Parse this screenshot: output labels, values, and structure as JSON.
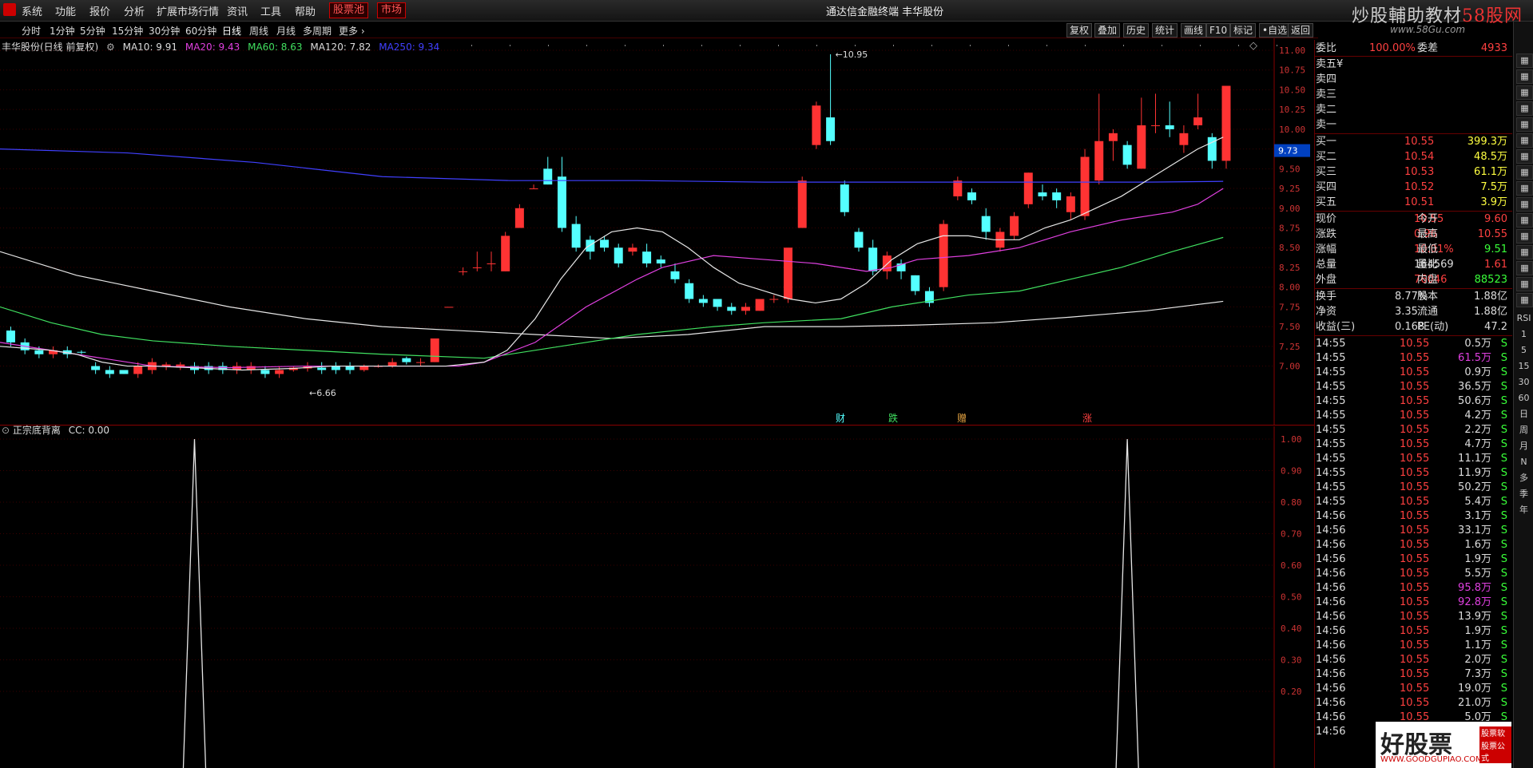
{
  "menubar": {
    "items": [
      "系统",
      "功能",
      "报价",
      "分析",
      "扩展市场行情",
      "资讯",
      "工具",
      "帮助"
    ],
    "boxed": [
      "股票池",
      "市场"
    ],
    "title": "通达信金融终端  丰华股份",
    "brand_a": "炒股輔助教材",
    "brand_b": "58股网",
    "brand_url": "www.58Gu.com"
  },
  "periods": [
    "分时",
    "1分钟",
    "5分钟",
    "15分钟",
    "30分钟",
    "60分钟",
    "日线",
    "周线",
    "月线",
    "多周期",
    "更多 ›"
  ],
  "tools": [
    "复权",
    "叠加",
    "历史",
    "统计",
    "画线",
    "F10",
    "标记",
    "•自选",
    "返回"
  ],
  "price_chart": {
    "title": "丰华股份(日线 前复权)",
    "ma10_label": "MA10: 9.91",
    "ma20_label": "MA20: 9.43",
    "ma60_label": "MA60: 8.63",
    "ma120_label": "MA120: 7.82",
    "ma250_label": "MA250: 9.34",
    "colors": {
      "ma10": "#e6e6e6",
      "ma20": "#e040e0",
      "ma60": "#40e060",
      "ma120": "#e6e6e6",
      "ma250": "#4040ff",
      "up": "#ff3333",
      "down": "#54ffff"
    },
    "y_ticks": [
      "11.00",
      "10.75",
      "10.50",
      "10.25",
      "10.00",
      "9.75",
      "9.50",
      "9.25",
      "9.00",
      "8.75",
      "8.50",
      "8.25",
      "8.00",
      "7.75",
      "7.50",
      "7.25",
      "7.00"
    ],
    "high_label": "10.95",
    "low_label": "6.66",
    "price_tag": "9.73",
    "events": [
      "财",
      "跌",
      "赠",
      "涨"
    ],
    "candles": [
      [
        7.45,
        7.3,
        7.5,
        7.25
      ],
      [
        7.3,
        7.2,
        7.35,
        7.15
      ],
      [
        7.2,
        7.15,
        7.25,
        7.1
      ],
      [
        7.15,
        7.2,
        7.25,
        7.1
      ],
      [
        7.2,
        7.15,
        7.25,
        7.1
      ],
      [
        7.18,
        7.17,
        7.2,
        7.15
      ],
      [
        7.0,
        6.95,
        7.05,
        6.9
      ],
      [
        6.95,
        6.9,
        7.0,
        6.85
      ],
      [
        6.95,
        6.9,
        6.95,
        6.9
      ],
      [
        6.9,
        7.0,
        7.05,
        6.85
      ],
      [
        6.95,
        7.05,
        7.1,
        6.9
      ],
      [
        7.0,
        7.02,
        7.05,
        6.95
      ],
      [
        6.98,
        7.02,
        7.05,
        6.95
      ],
      [
        7.0,
        6.95,
        7.05,
        6.9
      ],
      [
        7.0,
        6.95,
        7.05,
        6.9
      ],
      [
        7.0,
        6.95,
        7.05,
        6.9
      ],
      [
        6.95,
        7.0,
        7.05,
        6.9
      ],
      [
        6.95,
        7.0,
        7.05,
        6.9
      ],
      [
        6.95,
        6.9,
        7.0,
        6.85
      ],
      [
        6.9,
        6.95,
        7.0,
        6.85
      ],
      [
        6.95,
        6.98,
        7.0,
        6.93
      ],
      [
        6.97,
        7.0,
        7.05,
        6.93
      ],
      [
        6.98,
        6.95,
        7.05,
        6.9
      ],
      [
        7.0,
        6.95,
        7.05,
        6.9
      ],
      [
        7.0,
        6.95,
        7.05,
        6.9
      ],
      [
        6.95,
        7.0,
        7.02,
        6.93
      ],
      [
        7.0,
        7.0,
        7.02,
        6.98
      ],
      [
        7.0,
        7.05,
        7.1,
        6.98
      ],
      [
        7.1,
        7.05,
        7.12,
        7.02
      ],
      [
        7.05,
        7.05,
        7.1,
        7.0
      ],
      [
        7.05,
        7.35,
        7.35,
        7.05
      ],
      [
        7.75,
        7.75,
        7.75,
        7.75
      ],
      [
        8.2,
        8.2,
        8.25,
        8.15
      ],
      [
        8.25,
        8.25,
        8.45,
        8.2
      ],
      [
        8.3,
        8.3,
        8.45,
        8.2
      ],
      [
        8.2,
        8.65,
        8.7,
        8.2
      ],
      [
        8.75,
        9.0,
        9.05,
        8.75
      ],
      [
        9.25,
        9.25,
        9.3,
        9.25
      ],
      [
        9.5,
        9.3,
        9.65,
        9.3
      ],
      [
        9.4,
        8.75,
        9.65,
        8.7
      ],
      [
        8.8,
        8.5,
        8.9,
        8.45
      ],
      [
        8.6,
        8.45,
        8.65,
        8.35
      ],
      [
        8.6,
        8.5,
        8.65,
        8.45
      ],
      [
        8.5,
        8.3,
        8.55,
        8.25
      ],
      [
        8.45,
        8.5,
        8.55,
        8.4
      ],
      [
        8.45,
        8.3,
        8.55,
        8.25
      ],
      [
        8.35,
        8.3,
        8.4,
        8.25
      ],
      [
        8.2,
        8.1,
        8.3,
        8.05
      ],
      [
        8.05,
        7.85,
        8.1,
        7.8
      ],
      [
        7.85,
        7.8,
        7.9,
        7.75
      ],
      [
        7.85,
        7.75,
        7.85,
        7.7
      ],
      [
        7.75,
        7.7,
        7.8,
        7.65
      ],
      [
        7.7,
        7.75,
        7.8,
        7.65
      ],
      [
        7.7,
        7.85,
        7.85,
        7.7
      ],
      [
        7.85,
        7.85,
        7.9,
        7.8
      ],
      [
        7.85,
        8.5,
        8.5,
        7.8
      ],
      [
        8.75,
        9.35,
        9.4,
        8.75
      ],
      [
        9.8,
        10.3,
        10.35,
        9.75
      ],
      [
        10.15,
        9.85,
        10.95,
        9.8
      ],
      [
        9.3,
        8.95,
        9.35,
        8.9
      ],
      [
        8.7,
        8.5,
        8.75,
        8.45
      ],
      [
        8.5,
        8.2,
        8.6,
        8.15
      ],
      [
        8.2,
        8.4,
        8.45,
        8.1
      ],
      [
        8.3,
        8.2,
        8.35,
        8.1
      ],
      [
        8.15,
        7.95,
        8.15,
        7.9
      ],
      [
        7.95,
        7.8,
        8.0,
        7.75
      ],
      [
        8.0,
        8.8,
        8.85,
        7.95
      ],
      [
        9.15,
        9.35,
        9.4,
        9.1
      ],
      [
        9.2,
        9.1,
        9.25,
        9.05
      ],
      [
        8.9,
        8.7,
        9.0,
        8.6
      ],
      [
        8.5,
        8.7,
        8.75,
        8.45
      ],
      [
        8.65,
        8.9,
        8.95,
        8.6
      ],
      [
        9.05,
        9.45,
        9.45,
        9.0
      ],
      [
        9.2,
        9.15,
        9.3,
        9.1
      ],
      [
        9.2,
        9.1,
        9.25,
        9.0
      ],
      [
        8.95,
        9.15,
        9.2,
        8.85
      ],
      [
        8.9,
        9.65,
        9.75,
        8.85
      ],
      [
        9.35,
        9.85,
        10.45,
        9.3
      ],
      [
        9.85,
        9.95,
        10.0,
        9.6
      ],
      [
        9.8,
        9.55,
        9.85,
        9.5
      ],
      [
        9.5,
        10.05,
        10.4,
        9.5
      ],
      [
        10.05,
        10.05,
        10.45,
        9.95
      ],
      [
        10.05,
        10.0,
        10.35,
        9.9
      ],
      [
        9.8,
        9.95,
        10.05,
        9.7
      ],
      [
        10.05,
        10.15,
        10.45,
        10.0
      ],
      [
        9.9,
        9.6,
        9.95,
        9.5
      ],
      [
        9.6,
        10.55,
        10.55,
        9.5
      ]
    ],
    "ma10": [
      [
        0,
        7.25
      ],
      [
        40,
        7.2
      ],
      [
        60,
        7.15
      ],
      [
        80,
        7.05
      ],
      [
        100,
        7.0
      ],
      [
        120,
        7.0
      ],
      [
        150,
        6.98
      ],
      [
        190,
        6.95
      ],
      [
        230,
        6.97
      ],
      [
        260,
        7.0
      ],
      [
        300,
        7.0
      ],
      [
        320,
        7.0
      ],
      [
        350,
        7.0
      ],
      [
        380,
        7.05
      ],
      [
        398,
        7.2
      ],
      [
        420,
        7.6
      ],
      [
        440,
        8.1
      ],
      [
        460,
        8.5
      ],
      [
        480,
        8.7
      ],
      [
        500,
        8.75
      ],
      [
        520,
        8.7
      ],
      [
        540,
        8.5
      ],
      [
        560,
        8.25
      ],
      [
        580,
        8.05
      ],
      [
        600,
        7.95
      ],
      [
        620,
        7.85
      ],
      [
        640,
        7.8
      ],
      [
        660,
        7.85
      ],
      [
        680,
        8.05
      ],
      [
        700,
        8.35
      ],
      [
        720,
        8.55
      ],
      [
        740,
        8.65
      ],
      [
        760,
        8.65
      ],
      [
        780,
        8.6
      ],
      [
        800,
        8.6
      ],
      [
        820,
        8.75
      ],
      [
        840,
        8.85
      ],
      [
        860,
        9.0
      ],
      [
        880,
        9.15
      ],
      [
        900,
        9.35
      ],
      [
        920,
        9.55
      ],
      [
        940,
        9.75
      ],
      [
        960,
        9.9
      ]
    ],
    "ma20": [
      [
        0,
        7.3
      ],
      [
        60,
        7.15
      ],
      [
        120,
        7.0
      ],
      [
        180,
        6.98
      ],
      [
        240,
        7.0
      ],
      [
        300,
        7.0
      ],
      [
        360,
        7.0
      ],
      [
        380,
        7.05
      ],
      [
        420,
        7.3
      ],
      [
        460,
        7.75
      ],
      [
        500,
        8.1
      ],
      [
        520,
        8.25
      ],
      [
        560,
        8.4
      ],
      [
        600,
        8.35
      ],
      [
        640,
        8.3
      ],
      [
        680,
        8.2
      ],
      [
        700,
        8.25
      ],
      [
        720,
        8.35
      ],
      [
        760,
        8.4
      ],
      [
        800,
        8.5
      ],
      [
        840,
        8.7
      ],
      [
        880,
        8.85
      ],
      [
        920,
        8.95
      ],
      [
        940,
        9.05
      ],
      [
        960,
        9.25
      ]
    ],
    "ma60": [
      [
        0,
        7.75
      ],
      [
        40,
        7.55
      ],
      [
        80,
        7.4
      ],
      [
        120,
        7.32
      ],
      [
        180,
        7.25
      ],
      [
        240,
        7.2
      ],
      [
        300,
        7.15
      ],
      [
        380,
        7.1
      ],
      [
        440,
        7.25
      ],
      [
        500,
        7.4
      ],
      [
        560,
        7.5
      ],
      [
        600,
        7.55
      ],
      [
        660,
        7.6
      ],
      [
        700,
        7.75
      ],
      [
        760,
        7.9
      ],
      [
        800,
        7.95
      ],
      [
        840,
        8.1
      ],
      [
        880,
        8.25
      ],
      [
        920,
        8.45
      ],
      [
        960,
        8.63
      ]
    ],
    "ma120": [
      [
        0,
        8.45
      ],
      [
        60,
        8.15
      ],
      [
        120,
        7.95
      ],
      [
        180,
        7.75
      ],
      [
        240,
        7.6
      ],
      [
        300,
        7.5
      ],
      [
        360,
        7.45
      ],
      [
        420,
        7.4
      ],
      [
        480,
        7.35
      ],
      [
        540,
        7.4
      ],
      [
        600,
        7.5
      ],
      [
        660,
        7.5
      ],
      [
        720,
        7.52
      ],
      [
        780,
        7.55
      ],
      [
        840,
        7.62
      ],
      [
        900,
        7.7
      ],
      [
        960,
        7.82
      ]
    ],
    "ma250": [
      [
        0,
        9.75
      ],
      [
        100,
        9.7
      ],
      [
        200,
        9.58
      ],
      [
        300,
        9.4
      ],
      [
        400,
        9.35
      ],
      [
        500,
        9.35
      ],
      [
        600,
        9.33
      ],
      [
        700,
        9.33
      ],
      [
        800,
        9.33
      ],
      [
        900,
        9.33
      ],
      [
        960,
        9.34
      ]
    ]
  },
  "indicator": {
    "title": "正宗底背离",
    "cc_label": "CC: 0.00",
    "y_ticks": [
      "1.00",
      "0.90",
      "0.80",
      "0.70",
      "0.60",
      "0.50",
      "0.40",
      "0.30",
      "0.20"
    ],
    "spikes_at_candle": [
      13,
      79
    ]
  },
  "quote": {
    "wei": {
      "label": "委比",
      "v1": "100.00%",
      "l2": "委差",
      "v2": "4933"
    },
    "asks": [
      {
        "label": "卖五",
        "price": "",
        "vol": "",
        "mark": "¥"
      },
      {
        "label": "卖四",
        "price": "",
        "vol": ""
      },
      {
        "label": "卖三",
        "price": "",
        "vol": ""
      },
      {
        "label": "卖二",
        "price": "",
        "vol": ""
      },
      {
        "label": "卖一",
        "price": "",
        "vol": ""
      }
    ],
    "bids": [
      {
        "label": "买一",
        "price": "10.55",
        "vol": "399.3万"
      },
      {
        "label": "买二",
        "price": "10.54",
        "vol": "48.5万"
      },
      {
        "label": "买三",
        "price": "10.53",
        "vol": "61.1万"
      },
      {
        "label": "买四",
        "price": "10.52",
        "vol": "7.5万"
      },
      {
        "label": "买五",
        "price": "10.51",
        "vol": "3.9万"
      }
    ],
    "stats": [
      {
        "a": "现价",
        "av": "10.55",
        "ac": "up",
        "b": "今开",
        "bv": "9.60",
        "bc": "up"
      },
      {
        "a": "涨跌",
        "av": "0.96",
        "ac": "up",
        "b": "最高",
        "bv": "10.55",
        "bc": "up"
      },
      {
        "a": "涨幅",
        "av": "10.01%",
        "ac": "up",
        "b": "最低",
        "bv": "9.51",
        "bc": "dn"
      },
      {
        "a": "总量",
        "av": "164569",
        "ac": "wh",
        "b": "量比",
        "bv": "1.61",
        "bc": "up"
      },
      {
        "a": "外盘",
        "av": "76046",
        "ac": "up",
        "b": "内盘",
        "bv": "88523",
        "bc": "dn"
      }
    ],
    "stats2": [
      {
        "a": "换手",
        "av": "8.77%",
        "b": "股本",
        "bv": "1.88亿"
      },
      {
        "a": "净资",
        "av": "3.35",
        "b": "流通",
        "bv": "1.88亿"
      },
      {
        "a": "收益(三)",
        "av": "0.168",
        "b": "PE(动)",
        "bv": "47.2"
      }
    ],
    "ticks": [
      {
        "t": "14:55",
        "p": "10.55",
        "v": "0.5万",
        "c": "wh"
      },
      {
        "t": "14:55",
        "p": "10.55",
        "v": "61.5万",
        "c": "mg"
      },
      {
        "t": "14:55",
        "p": "10.55",
        "v": "0.9万",
        "c": "wh"
      },
      {
        "t": "14:55",
        "p": "10.55",
        "v": "36.5万",
        "c": "wh"
      },
      {
        "t": "14:55",
        "p": "10.55",
        "v": "50.6万",
        "c": "wh"
      },
      {
        "t": "14:55",
        "p": "10.55",
        "v": "4.2万",
        "c": "wh"
      },
      {
        "t": "14:55",
        "p": "10.55",
        "v": "2.2万",
        "c": "wh"
      },
      {
        "t": "14:55",
        "p": "10.55",
        "v": "4.7万",
        "c": "wh"
      },
      {
        "t": "14:55",
        "p": "10.55",
        "v": "11.1万",
        "c": "wh"
      },
      {
        "t": "14:55",
        "p": "10.55",
        "v": "11.9万",
        "c": "wh"
      },
      {
        "t": "14:55",
        "p": "10.55",
        "v": "50.2万",
        "c": "wh"
      },
      {
        "t": "14:55",
        "p": "10.55",
        "v": "5.4万",
        "c": "wh"
      },
      {
        "t": "14:56",
        "p": "10.55",
        "v": "3.1万",
        "c": "wh"
      },
      {
        "t": "14:56",
        "p": "10.55",
        "v": "33.1万",
        "c": "wh"
      },
      {
        "t": "14:56",
        "p": "10.55",
        "v": "1.6万",
        "c": "wh"
      },
      {
        "t": "14:56",
        "p": "10.55",
        "v": "1.9万",
        "c": "wh"
      },
      {
        "t": "14:56",
        "p": "10.55",
        "v": "5.5万",
        "c": "wh"
      },
      {
        "t": "14:56",
        "p": "10.55",
        "v": "95.8万",
        "c": "mg"
      },
      {
        "t": "14:56",
        "p": "10.55",
        "v": "92.8万",
        "c": "mg"
      },
      {
        "t": "14:56",
        "p": "10.55",
        "v": "13.9万",
        "c": "wh"
      },
      {
        "t": "14:56",
        "p": "10.55",
        "v": "1.9万",
        "c": "wh"
      },
      {
        "t": "14:56",
        "p": "10.55",
        "v": "1.1万",
        "c": "wh"
      },
      {
        "t": "14:56",
        "p": "10.55",
        "v": "2.0万",
        "c": "wh"
      },
      {
        "t": "14:56",
        "p": "10.55",
        "v": "7.3万",
        "c": "wh"
      },
      {
        "t": "14:56",
        "p": "10.55",
        "v": "19.0万",
        "c": "wh"
      },
      {
        "t": "14:56",
        "p": "10.55",
        "v": "21.0万",
        "c": "wh"
      },
      {
        "t": "14:56",
        "p": "10.55",
        "v": "5.0万",
        "c": "wh"
      },
      {
        "t": "14:56",
        "p": "10.55",
        "v": "",
        "c": "wh"
      }
    ],
    "tick_side": "S"
  },
  "strip_icons": [
    "grid-icon",
    "chart-icon",
    "bar-icon",
    "candle-icon",
    "line-icon",
    "rsi-icon",
    "macd-icon",
    "kdj-icon",
    "vol-icon",
    "obv-icon",
    "boll-icon",
    "cci-icon",
    "dmi-icon",
    "wr-icon",
    "bias-icon",
    "more-icon"
  ],
  "strip_labels": [
    "RSI",
    "1",
    "5",
    "15",
    "30",
    "60",
    "日",
    "周",
    "月",
    "N",
    "多",
    "季",
    "年"
  ],
  "footer_watermark": {
    "text": "好股票",
    "url": "WWW.GOODGUPIAO.COM",
    "tag1": "股票软件",
    "tag2": "股票公式"
  }
}
